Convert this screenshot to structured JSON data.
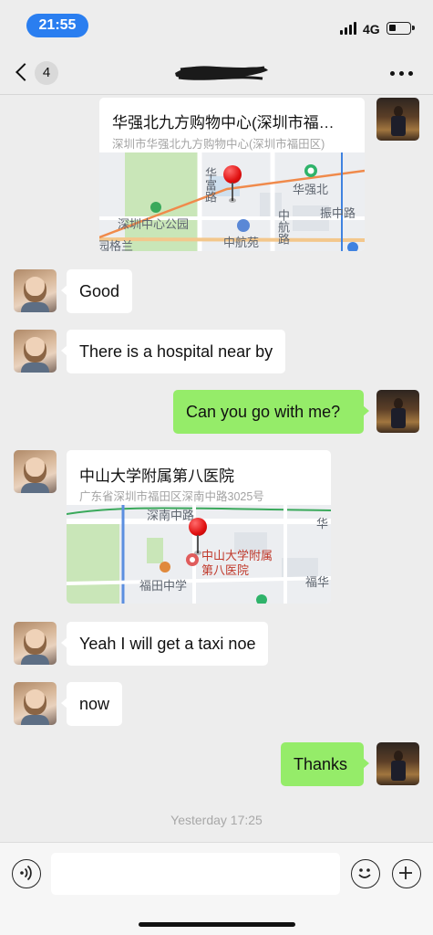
{
  "status_bar": {
    "time": "21:55",
    "network": "4G"
  },
  "nav": {
    "back_count": "4"
  },
  "messages": {
    "loc1": {
      "name": "华强北九方购物中心(深圳市福…",
      "address": "深圳市华强北九方购物中心(深圳市福田区)",
      "map_labels": {
        "l1": "华强北",
        "l2": "振中路",
        "l3": "深圳中心公园",
        "l4": "中航苑",
        "l5": "华富路",
        "l6": "中航路",
        "l7": "园格兰"
      }
    },
    "m1": "Good",
    "m2": "There is a hospital near by",
    "m3": "Can you go with me?",
    "loc2": {
      "name": "中山大学附属第八医院",
      "address": "广东省深圳市福田区深南中路3025号",
      "map_labels": {
        "l1": "深南中路",
        "l2": "中山大学附属",
        "l3": "第八医院",
        "l4": "福田中学",
        "l5": "华",
        "l6": "福华"
      }
    },
    "m4": "Yeah I will get a taxi noe",
    "m5": "now",
    "m6": "Thanks"
  },
  "timestamp": "Yesterday 17:25",
  "input": {
    "placeholder": ""
  },
  "icons": {
    "voice": "voice-icon",
    "emoji": "emoji-icon",
    "plus": "plus-icon",
    "back": "chevron-left-icon",
    "more": "more-icon",
    "map_pin": "map-pin-icon"
  },
  "colors": {
    "time_pill": "#2a7ef0",
    "outgoing_bubble": "#95ec69",
    "incoming_bubble": "#ffffff",
    "background": "#ededed"
  }
}
